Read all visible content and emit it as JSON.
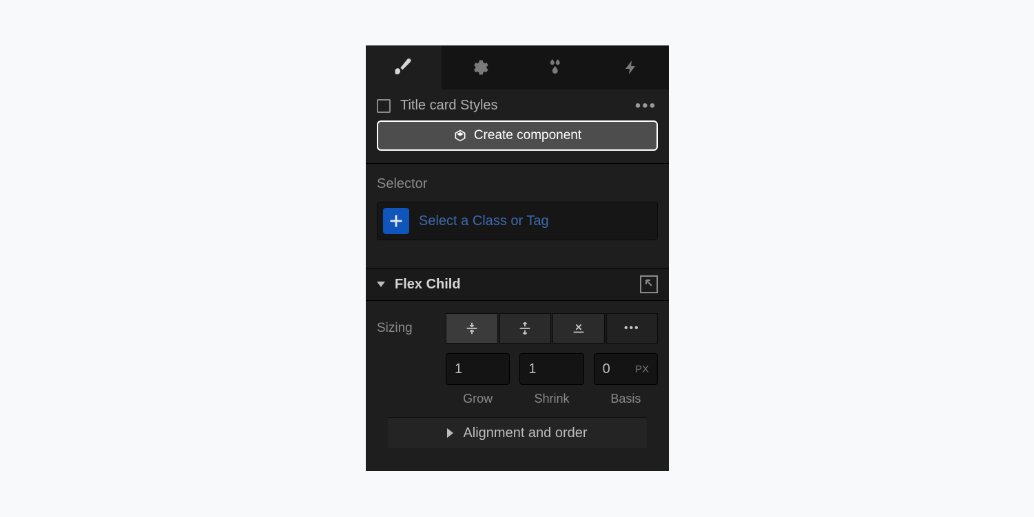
{
  "tabs": [
    "style",
    "settings",
    "effects",
    "interactions"
  ],
  "element": {
    "name": "Title card Styles"
  },
  "create_component": {
    "label": "Create component"
  },
  "selector": {
    "label": "Selector",
    "placeholder": "Select a Class or Tag"
  },
  "flex_child": {
    "title": "Flex Child",
    "sizing_label": "Sizing",
    "grow": "1",
    "shrink": "1",
    "basis": "0",
    "basis_unit": "PX",
    "grow_label": "Grow",
    "shrink_label": "Shrink",
    "basis_label": "Basis",
    "alignment_label": "Alignment and order"
  }
}
